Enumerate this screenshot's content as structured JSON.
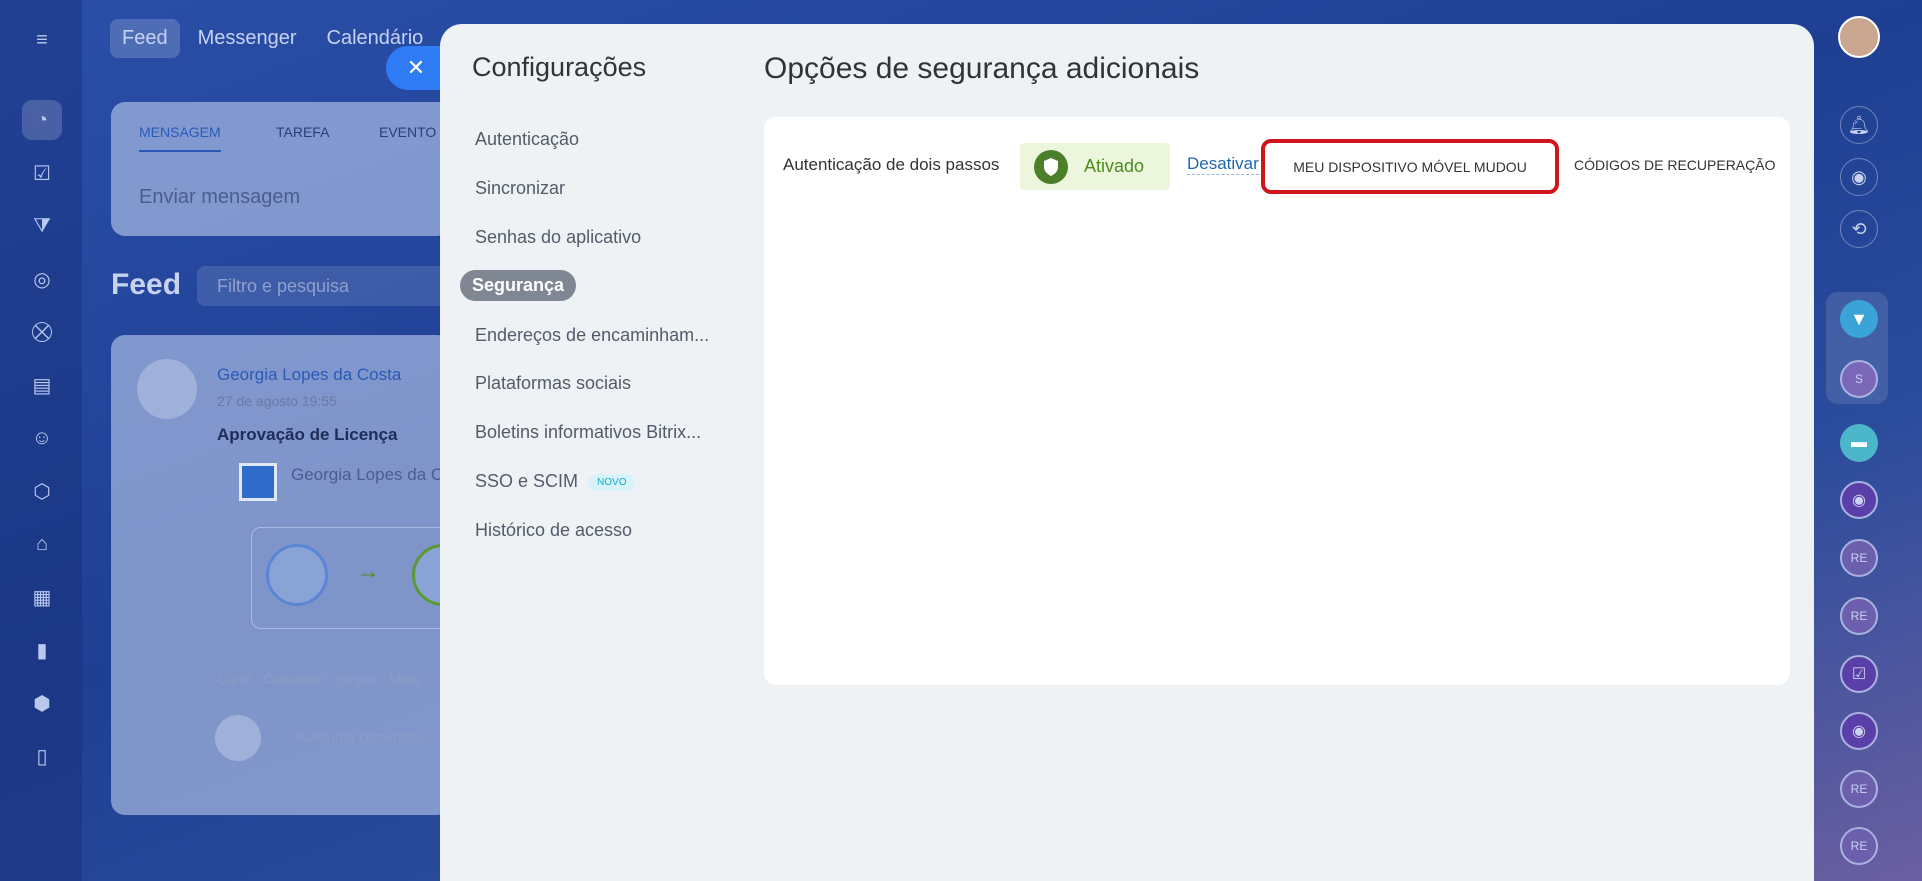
{
  "top_nav": [
    "Feed",
    "Messenger",
    "Calendário"
  ],
  "composer": {
    "tabs": [
      "MENSAGEM",
      "TAREFA",
      "EVENTO"
    ],
    "placeholder": "Enviar mensagem"
  },
  "feed": {
    "title": "Feed",
    "filter_placeholder": "Filtro e pesquisa",
    "post": {
      "author": "Georgia Lopes da Costa",
      "date": "27 de agosto 19:55",
      "title": "Aprovação de Licença",
      "body_author": "Georgia Lopes da C",
      "actions": [
        "Curtir",
        "Comentar",
        "Seguir",
        "Mais"
      ],
      "comment_placeholder": "Adicionar comentário"
    }
  },
  "settings": {
    "title": "Configurações",
    "menu": [
      {
        "label": "Autenticação"
      },
      {
        "label": "Sincronizar"
      },
      {
        "label": "Senhas do aplicativo"
      },
      {
        "label": "Segurança"
      },
      {
        "label": "Endereços de encaminham..."
      },
      {
        "label": "Plataformas sociais"
      },
      {
        "label": "Boletins informativos Bitrix..."
      },
      {
        "label": "SSO e SCIM",
        "badge": "NOVO"
      },
      {
        "label": "Histórico de acesso"
      }
    ],
    "selected": "Segurança"
  },
  "security": {
    "title": "Opções de segurança adicionais",
    "two_step_label": "Autenticação de dois passos",
    "status": "Ativado",
    "deactivate": "Desativar",
    "mobile_changed": "MEU DISPOSITIVO MÓVEL MUDOU",
    "recovery_codes": "CÓDIGOS DE RECUPERAÇÃO"
  },
  "right_rail": {
    "initials_s": "S",
    "initials_re": "RE"
  },
  "colors": {
    "accent": "#2f7bf5",
    "highlight": "#d0161c",
    "status_bg": "#ecf6dc",
    "status_text": "#4c8b1f"
  }
}
